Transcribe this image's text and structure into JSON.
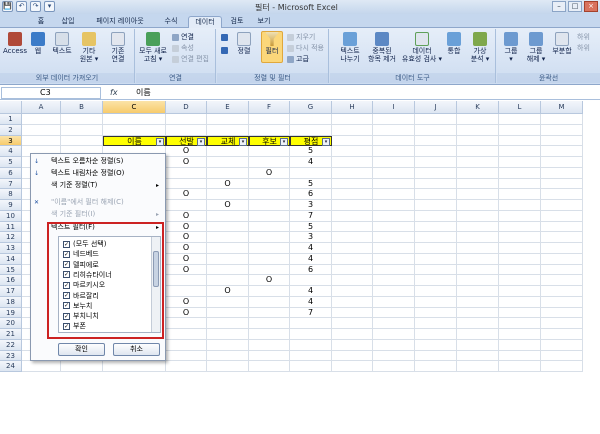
{
  "window": {
    "title": "필터 - Microsoft Excel",
    "min": "–",
    "max": "□",
    "close": "×"
  },
  "qat": [
    "💾",
    "↶",
    "↷",
    "▾"
  ],
  "tabs": [
    {
      "label": "홈"
    },
    {
      "label": "삽입"
    },
    {
      "label": "페이지 레이아웃"
    },
    {
      "label": "수식"
    },
    {
      "label": "데이터"
    },
    {
      "label": "검토"
    },
    {
      "label": "보기"
    }
  ],
  "ribbon": {
    "g1": {
      "label": "외부 데이터 가져오기",
      "btns": [
        "Access",
        "웹",
        "텍스트",
        "기타\n원본 ▾",
        "기존\n연결"
      ]
    },
    "g2": {
      "label": "연결",
      "refresh": "모두 새로\n고침 ▾",
      "conn": "연결",
      "prop": "속성",
      "edit": "연결 편집"
    },
    "g3": {
      "label": "정렬 및 필터",
      "sort": "정렬",
      "filter": "필터",
      "clear": "지우기",
      "reapply": "다시 적용",
      "adv": "고급"
    },
    "g4": {
      "label": "데이터 도구",
      "b1": "텍스트\n나누기",
      "b2": "중복된\n항목 제거",
      "b3": "데이터\n유효성 검사 ▾",
      "b4": "통합",
      "b5": "가상\n분석 ▾"
    },
    "g5": {
      "label": "윤곽선",
      "b1": "그룹\n▾",
      "b2": "그룹\n해제 ▾",
      "b3": "부분합",
      "s1": "하위",
      "s2": "하위"
    }
  },
  "formula": {
    "namebox": "C3",
    "fx": "fx",
    "content": "이름"
  },
  "columns": [
    "A",
    "B",
    "C",
    "D",
    "E",
    "F",
    "G",
    "H",
    "I",
    "J",
    "K",
    "L",
    "M"
  ],
  "rows": [
    "1",
    "2",
    "3",
    "4",
    "5",
    "6",
    "7",
    "8",
    "9",
    "10",
    "11",
    "12",
    "13",
    "14",
    "15",
    "16",
    "17",
    "18",
    "19",
    "20",
    "21",
    "22",
    "23",
    "24"
  ],
  "headers": {
    "C": "이름",
    "D": "선발",
    "E": "교체",
    "F": "후보",
    "G": "평점"
  },
  "dd": "▾",
  "data": {
    "D": {
      "4": "O",
      "5": "O",
      "8": "O",
      "10": "O",
      "11": "O",
      "12": "O",
      "13": "O",
      "14": "O",
      "15": "O",
      "18": "O",
      "19": "O"
    },
    "E": {
      "7": "O",
      "9": "O",
      "17": "O"
    },
    "F": {
      "6": "O",
      "16": "O"
    },
    "G": {
      "4": "5",
      "5": "4",
      "7": "5",
      "8": "6",
      "9": "3",
      "10": "7",
      "11": "5",
      "12": "3",
      "13": "4",
      "14": "4",
      "15": "6",
      "17": "4",
      "18": "4",
      "19": "7"
    }
  },
  "menu": {
    "items": [
      {
        "icon": "↓",
        "label": "텍스트 오름차순 정렬(S)",
        "dis": false,
        "arrow": ""
      },
      {
        "icon": "↓",
        "label": "텍스트 내림차순 정렬(O)",
        "dis": false,
        "arrow": ""
      },
      {
        "icon": "",
        "label": "색 기준 정렬(T)",
        "dis": false,
        "arrow": "▸"
      },
      {
        "icon": "✕",
        "label": "\"이름\"에서 필터 해제(C)",
        "dis": true,
        "arrow": ""
      },
      {
        "icon": "",
        "label": "색 기준 필터(I)",
        "dis": true,
        "arrow": "▸"
      },
      {
        "icon": "",
        "label": "텍스트 필터(F)",
        "dis": false,
        "arrow": "▸"
      }
    ],
    "list": [
      "(모두 선택)",
      "네드베드",
      "델피에로",
      "리히슈타이너",
      "마르키시오",
      "바르잘리",
      "보누치",
      "부치니치",
      "부폰"
    ],
    "check": "✓",
    "ok": "확인",
    "cancel": "취소"
  },
  "colors": {
    "header_fill": "#ffff00",
    "highlight": "#cc2222",
    "selected_hdr": "#f7cb6c"
  }
}
